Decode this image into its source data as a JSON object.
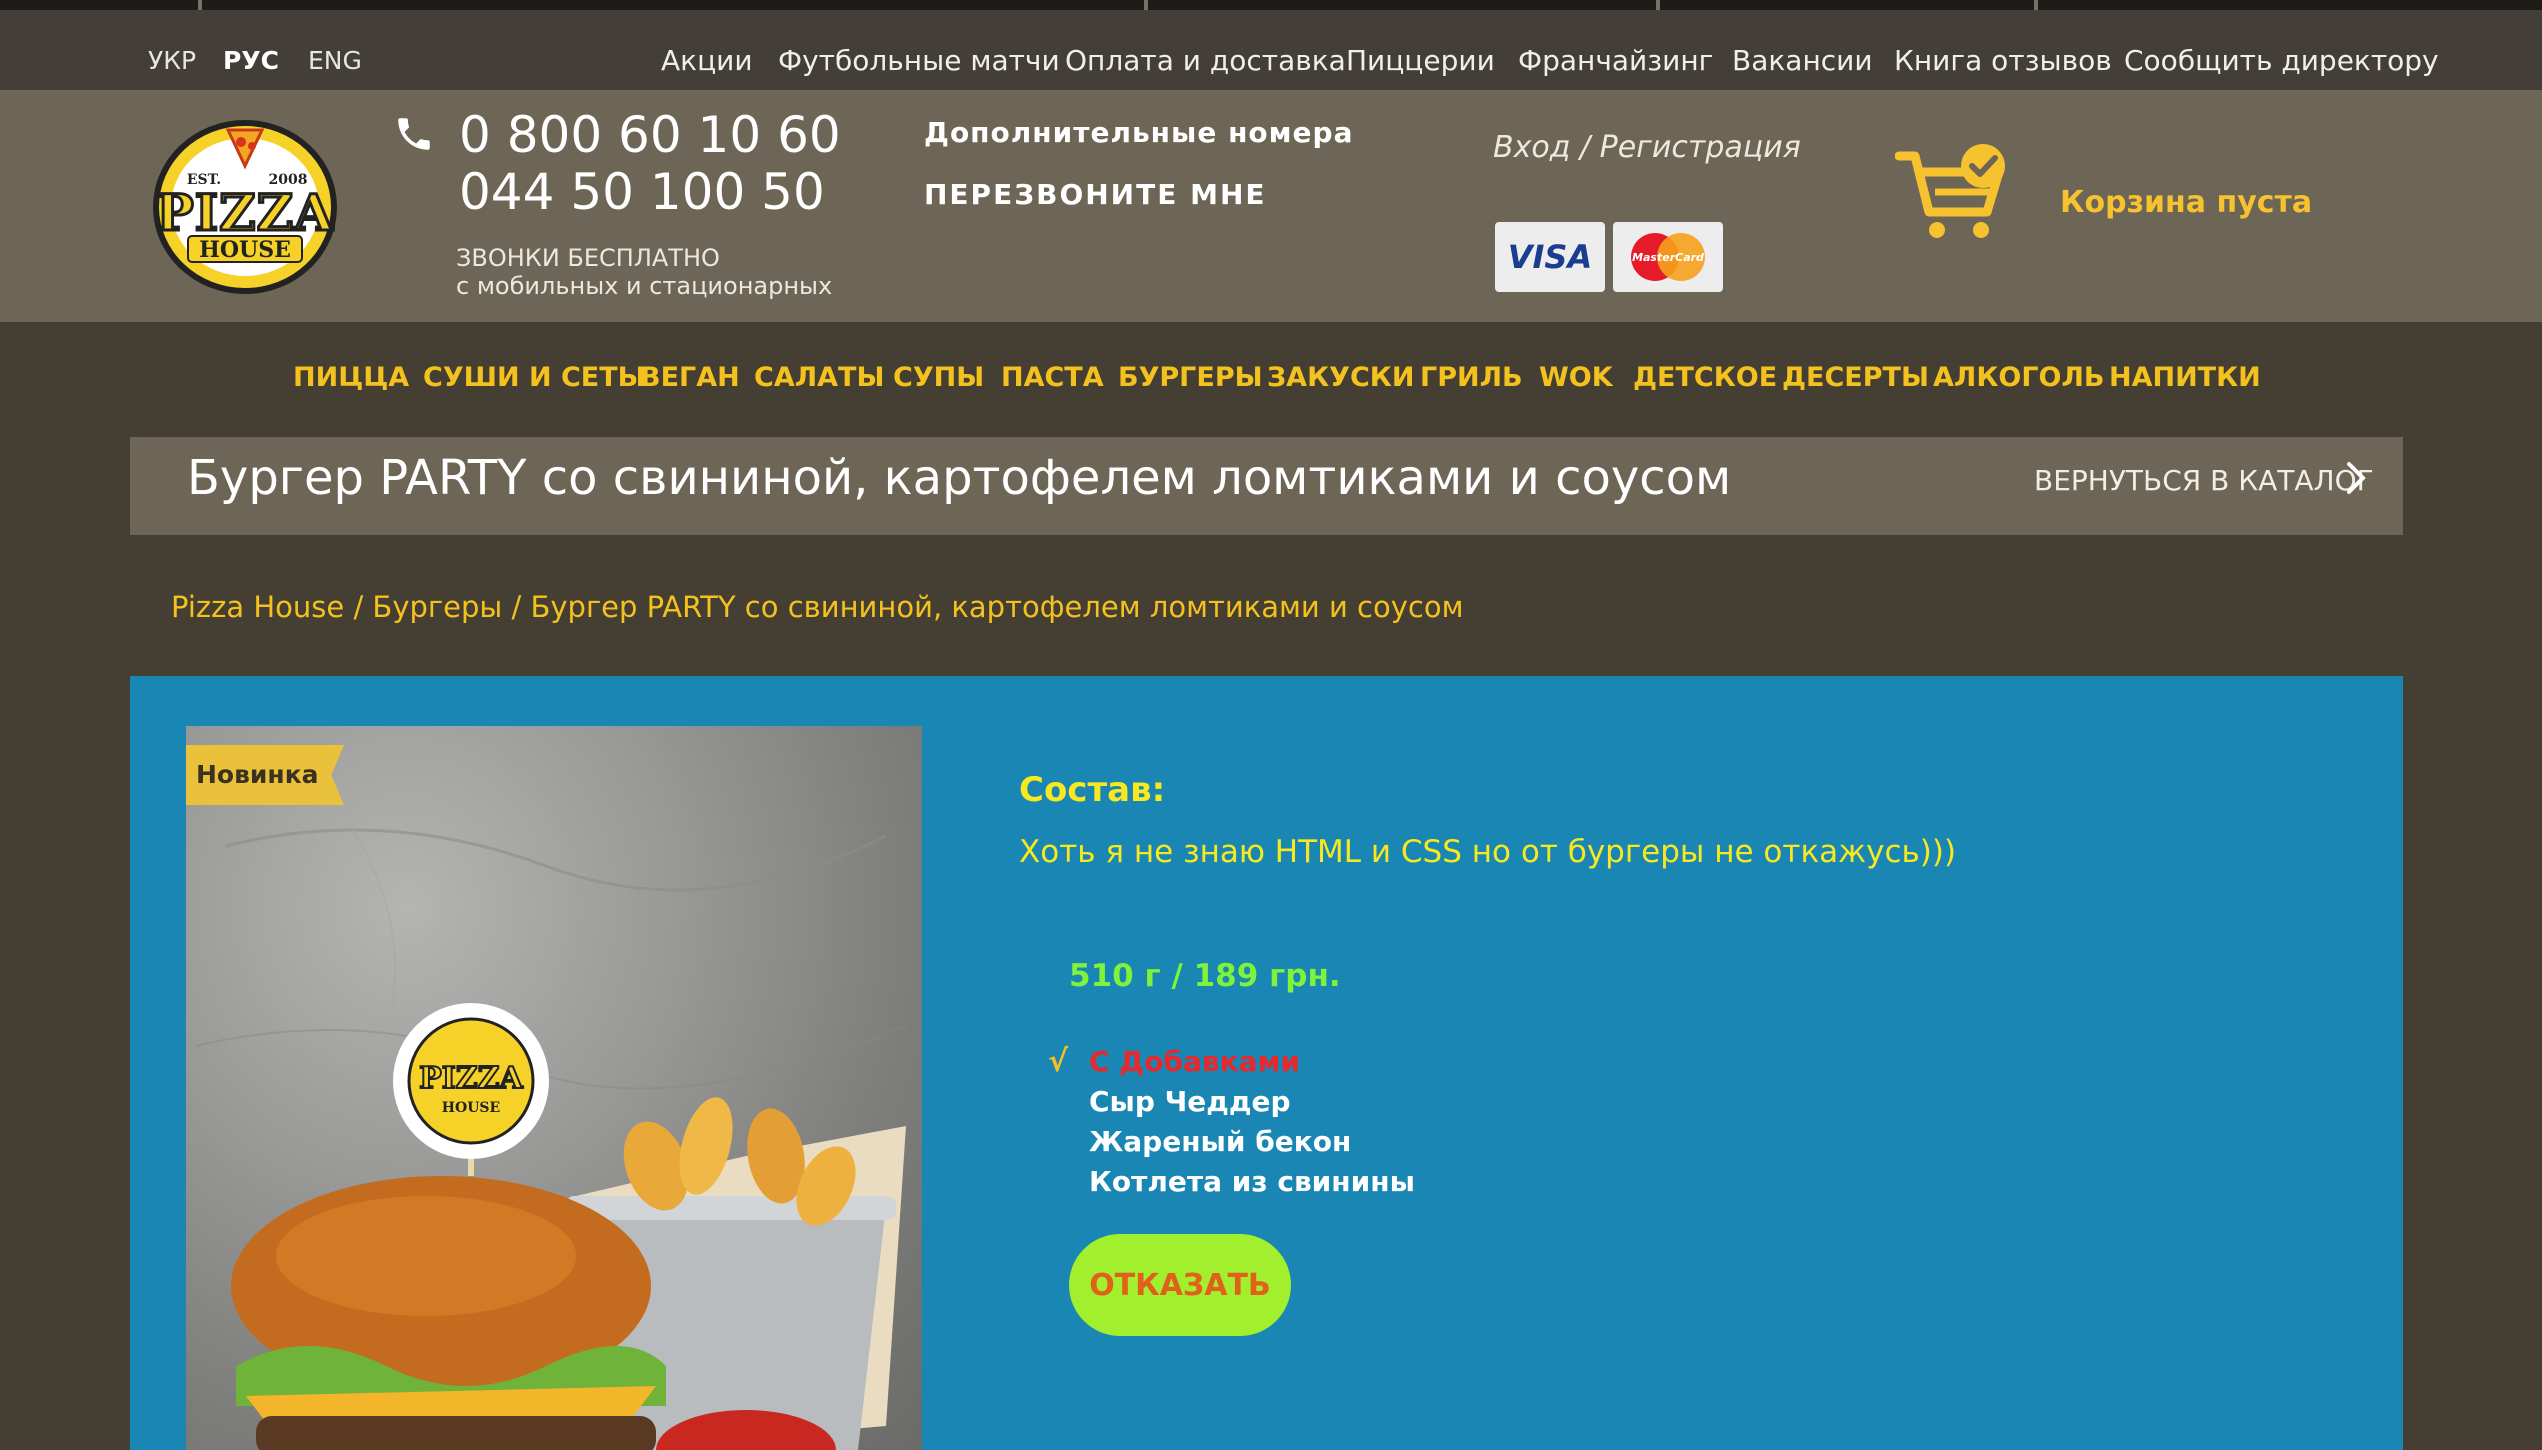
{
  "languages": [
    {
      "label": "УКР",
      "active": false
    },
    {
      "label": "РУС",
      "active": true
    },
    {
      "label": "ENG",
      "active": false
    }
  ],
  "top_nav": [
    "Акции",
    "Футбольные матчи",
    "Оплата и доставка",
    "Пиццерии",
    "Франчайзинг",
    "Вакансии",
    "Книга отзывов",
    "Сообщить директору"
  ],
  "logo": {
    "line1": "EST.",
    "line2": "2008",
    "word1": "PIZZA",
    "word2": "HOUSE"
  },
  "header": {
    "phone1": "0 800 60 10 60",
    "phone2": "044 50 100 50",
    "free_calls": "ЗВОНКИ БЕСПЛАТНО",
    "free_calls_sub": "с мобильных и стационарных",
    "extra_numbers": "Дополнительные номера",
    "call_me_back": "ПЕРЕЗВОНИТЕ МНЕ",
    "login": "Вход / Регистрация",
    "visa": "VISA",
    "mastercard": "MasterCard",
    "cart": "Корзина пуста"
  },
  "categories": [
    "ПИЦЦА",
    "СУШИ И СЕТЫ",
    "ВЕГАН",
    "САЛАТЫ",
    "СУПЫ",
    "ПАСТА",
    "БУРГЕРЫ",
    "ЗАКУСКИ",
    "ГРИЛЬ",
    "WOK",
    "ДЕТСКОЕ",
    "ДЕСЕРТЫ",
    "АЛКОГОЛЬ",
    "НАПИТКИ"
  ],
  "product": {
    "title": "Бургер PARTY со свининой, картофелем ломтиками и соусом",
    "back_to_catalog": "ВЕРНУТЬСЯ В КАТАЛОГ",
    "breadcrumb": "Pizza House / Бургеры / Бургер PARTY со свининой, картофелем ломтиками и соусом",
    "badge": "Новинка",
    "composition_label": "Состав:",
    "description": "Хоть я не знаю HTML и CSS но от бургеры не откажусь)))",
    "price": "510 г / 189 грн.",
    "check_mark": "√",
    "option_label": "С Добавками",
    "options": [
      "Сыр Чеддер",
      "Жареный бекон",
      "Котлета из свинины"
    ],
    "refuse_button": "ОТКАЗАТЬ"
  },
  "colors": {
    "accent_yellow": "#f4c21e",
    "panel_blue": "#1a86b3",
    "button_green": "#a2f02d",
    "price_green": "#7ef33a",
    "option_red": "#e8282a"
  }
}
